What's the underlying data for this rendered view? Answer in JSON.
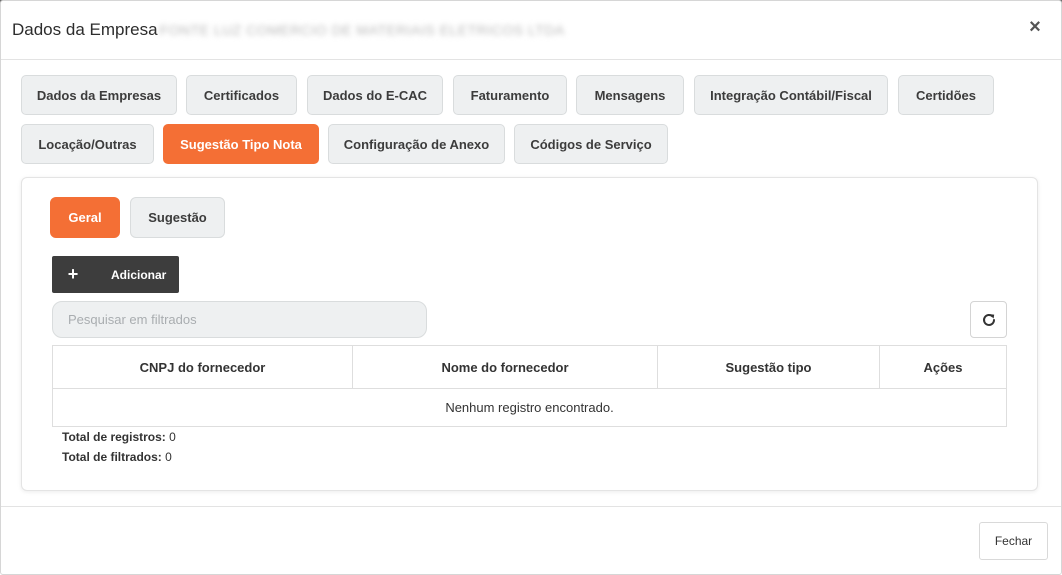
{
  "modal": {
    "title": "Dados da Empresa",
    "company_name": "FONTE LUZ COMERCIO DE MATERIAIS ELETRICOS LTDA",
    "close_symbol": "×"
  },
  "tabs": [
    {
      "label": "Dados da Empresas",
      "active": false
    },
    {
      "label": "Certificados",
      "active": false
    },
    {
      "label": "Dados do E-CAC",
      "active": false
    },
    {
      "label": "Faturamento",
      "active": false
    },
    {
      "label": "Mensagens",
      "active": false
    },
    {
      "label": "Integração Contábil/Fiscal",
      "active": false
    },
    {
      "label": "Certidões",
      "active": false
    },
    {
      "label": "Locação/Outras",
      "active": false
    },
    {
      "label": "Sugestão Tipo Nota",
      "active": true
    },
    {
      "label": "Configuração de Anexo",
      "active": false
    },
    {
      "label": "Códigos de Serviço",
      "active": false
    }
  ],
  "subtabs": [
    {
      "label": "Geral",
      "active": true
    },
    {
      "label": "Sugestão",
      "active": false
    }
  ],
  "toolbar": {
    "add_symbol": "+",
    "add_label": "Adicionar",
    "search_placeholder": "Pesquisar em filtrados",
    "search_value": "",
    "refresh_icon": "refresh-icon"
  },
  "table": {
    "columns": [
      "CNPJ do fornecedor",
      "Nome do fornecedor",
      "Sugestão tipo",
      "Ações"
    ],
    "empty_message": "Nenhum registro encontrado."
  },
  "totals": {
    "records_label": "Total de registros:",
    "records_value": "0",
    "filtered_label": "Total de filtrados:",
    "filtered_value": "0"
  },
  "footer": {
    "close_label": "Fechar"
  },
  "colors": {
    "accent": "#f46f35",
    "dark_button": "#3d3d3d",
    "tab_bg": "#eef0f1"
  }
}
